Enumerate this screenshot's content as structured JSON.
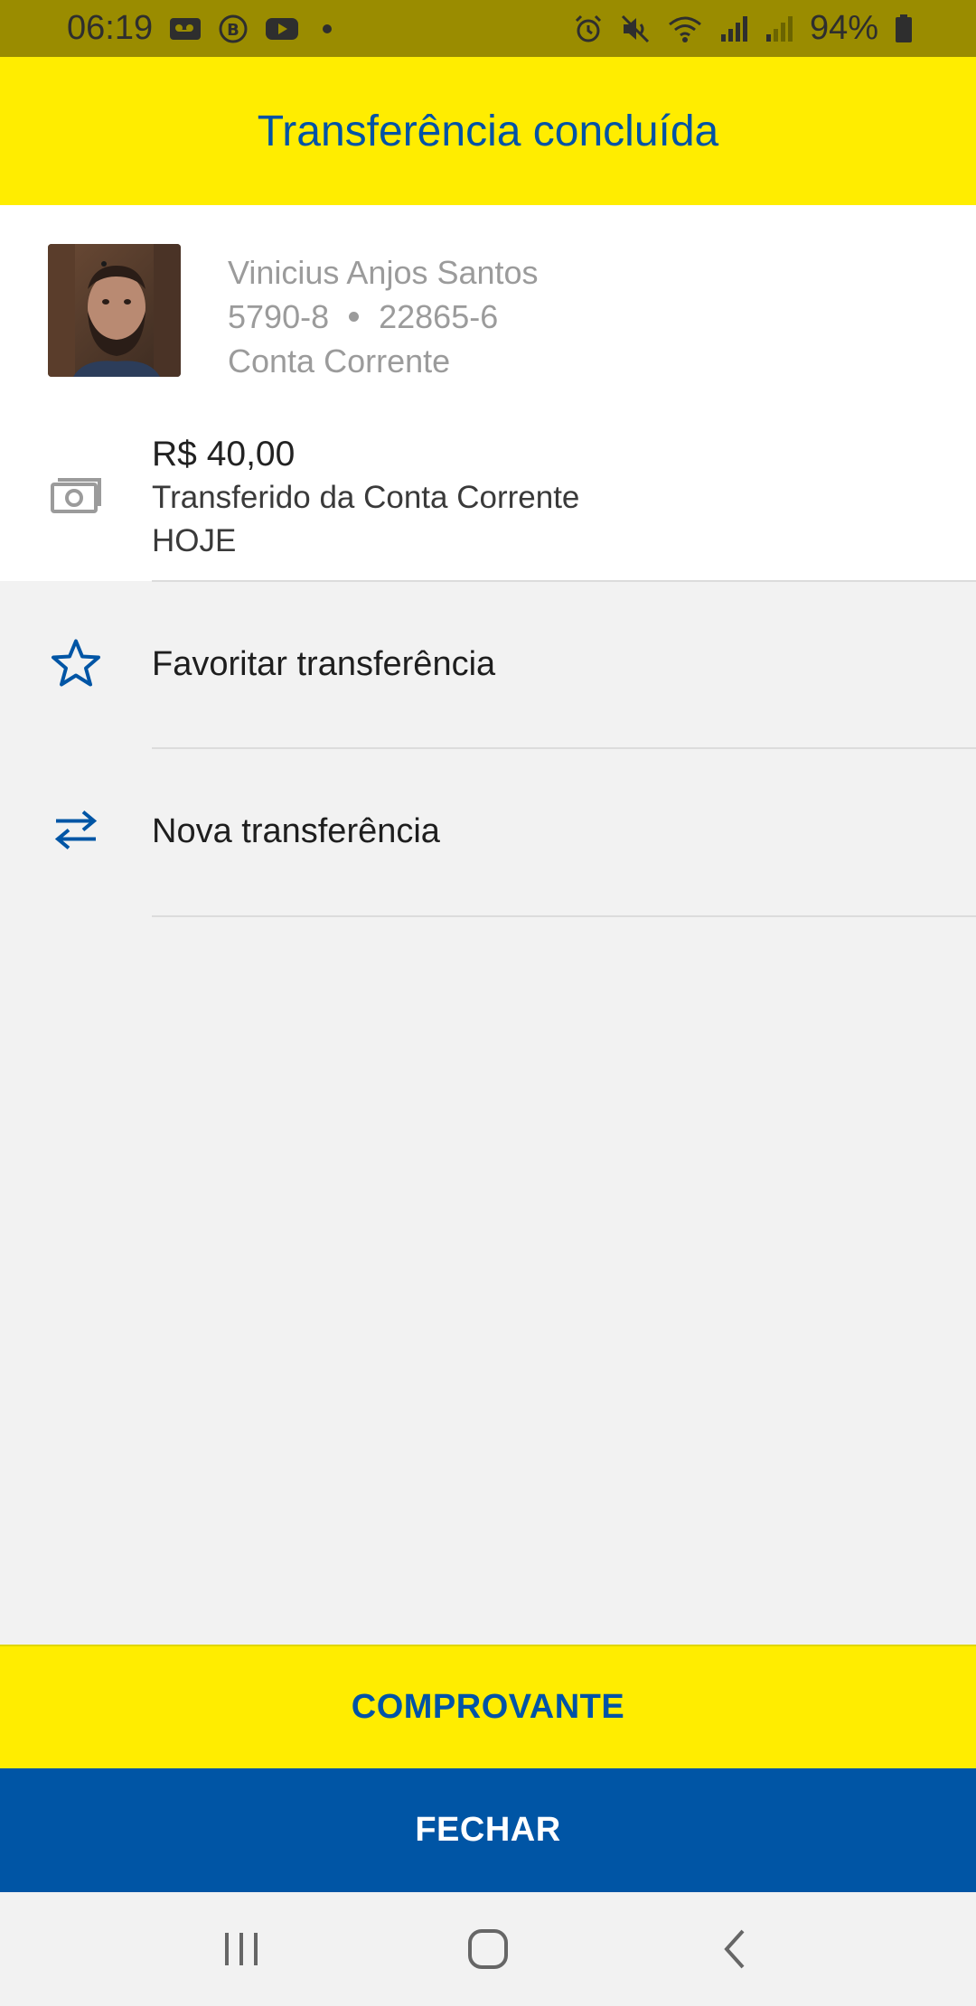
{
  "status_bar": {
    "time": "06:19",
    "battery": "94%"
  },
  "header": {
    "title": "Transferência concluída"
  },
  "recipient": {
    "name": "Vinicius Anjos Santos",
    "agency": "5790-8",
    "account": "22865-6",
    "account_type": "Conta Corrente"
  },
  "transfer": {
    "amount": "R$ 40,00",
    "source": "Transferido da Conta Corrente",
    "date": "HOJE"
  },
  "actions": {
    "favorite_label": "Favoritar transferência",
    "new_transfer_label": "Nova transferência"
  },
  "buttons": {
    "receipt_label": "COMPROVANTE",
    "close_label": "FECHAR"
  },
  "colors": {
    "brand_yellow": "#ffed00",
    "brand_blue": "#0055a5",
    "status_bar": "#9a8c00"
  },
  "icons": {
    "money": "money-bill-icon",
    "star": "star-outline-icon",
    "transfer": "swap-arrows-icon"
  }
}
